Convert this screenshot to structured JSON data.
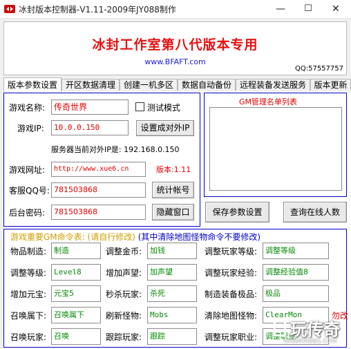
{
  "window": {
    "title": "冰封版本控制器-V1.11-2009年JY088制作",
    "minimize": "—",
    "maximize": "☐",
    "close": "✕"
  },
  "banner": {
    "title": "冰封工作室第八代版本专用",
    "url": "www.BFAFT.com",
    "qq": "QQ:57557757"
  },
  "tabs": [
    {
      "label": "版本参数设置",
      "active": true
    },
    {
      "label": "开区数据清理",
      "active": false
    },
    {
      "label": "创建一机多区",
      "active": false
    },
    {
      "label": "数据自动备份",
      "active": false
    },
    {
      "label": "远程装备发送服务",
      "active": false
    },
    {
      "label": "版本更新",
      "active": false
    }
  ],
  "settings": {
    "game_name_label": "游戏名称:",
    "game_name_value": "传奇世界",
    "test_mode_label": "测试模式",
    "game_ip_label": "游戏IP:",
    "game_ip_value": "10.0.0.150",
    "set_public_ip_button": "设置成对外IP",
    "server_ip_text": "服务器当前对外IP是: 192.168.0.150",
    "game_url_label": "游戏网址:",
    "game_url_value": "http://www.xue6.cn",
    "version_text": "版本:1.11",
    "service_qq_label": "客服QQ号:",
    "service_qq_value": "781503868",
    "stats_button": "统计帐号",
    "admin_password_label": "后台密码:",
    "admin_password_value": "781503868",
    "hide_window_button": "隐藏窗口",
    "gm_list_title": "GM管理名单列表",
    "save_button": "保存参数设置",
    "online_button": "查询在线人数"
  },
  "commands": {
    "header_part1": "游戏重要GM命令表: (请自行修改)",
    "header_part2": "(其中清除地图怪物命令不要修改)",
    "items": [
      {
        "label": "物品制造:",
        "value": "制造"
      },
      {
        "label": "调整金币:",
        "value": "加钱"
      },
      {
        "label": "调整玩家等级:",
        "value": "调整等级"
      },
      {
        "label": "调整等级:",
        "value": "Level8"
      },
      {
        "label": "增加声望:",
        "value": "加声望"
      },
      {
        "label": "调整玩家经验:",
        "value": "调整经验值8"
      },
      {
        "label": "增加元宝:",
        "value": "元宝5"
      },
      {
        "label": "秒杀玩家:",
        "value": "杀死"
      },
      {
        "label": "制造装备极品:",
        "value": "极品"
      },
      {
        "label": "召唤属下:",
        "value": "召唤属下"
      },
      {
        "label": "刷新怪物:",
        "value": "Mobs"
      },
      {
        "label": "清除地图怪物:",
        "value": "ClearMon"
      },
      {
        "label": "召唤玩家:",
        "value": "召唤"
      },
      {
        "label": "跟踪玩家:",
        "value": "跟踪"
      },
      {
        "label": "调整玩家职业:",
        "value": "调整职业"
      }
    ],
    "warning_text": "勿改"
  },
  "watermark": {
    "text": "玩传奇",
    "sub": "WANMIRBBS.COM"
  },
  "colors": {
    "banner_title": "#e81010",
    "url": "#1a1ad0",
    "group_border": "#0000c8",
    "value_red": "#e00000",
    "command_green": "#0a8a0a"
  }
}
